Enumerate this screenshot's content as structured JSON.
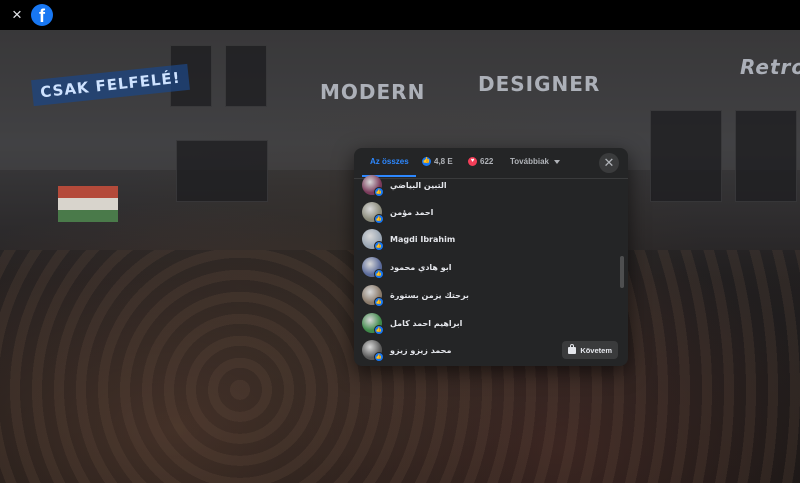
{
  "photo": {
    "signs": {
      "csak": "CSAK FELFELÉ!",
      "modern": "MODERN",
      "designer": "DESIGNER",
      "retro": "Retro"
    }
  },
  "topbar": {
    "close_icon": "×",
    "logo_letter": "f"
  },
  "reactions": {
    "tabs": {
      "all": "Az összes",
      "like_count": "4,8 E",
      "love_count": "622",
      "more": "Továbbiak"
    },
    "close_icon": "✕",
    "people": [
      {
        "name": "التبين البياضي",
        "color": "#7a3a5a"
      },
      {
        "name": "احمد مؤمن",
        "color": "#8a8a7a"
      },
      {
        "name": "Magdi Ibrahim",
        "color": "#9aa6b4"
      },
      {
        "name": "ابو هادي محمود",
        "color": "#5a6a9a"
      },
      {
        "name": "برحتك يزمن بستورة",
        "color": "#8a7a6a"
      },
      {
        "name": "ابراهيم احمد كامل",
        "color": "#3f8a4a"
      },
      {
        "name": "محمد زيزو زيزو",
        "color": "#5a5a5a"
      }
    ],
    "follow_label": "Követem"
  }
}
